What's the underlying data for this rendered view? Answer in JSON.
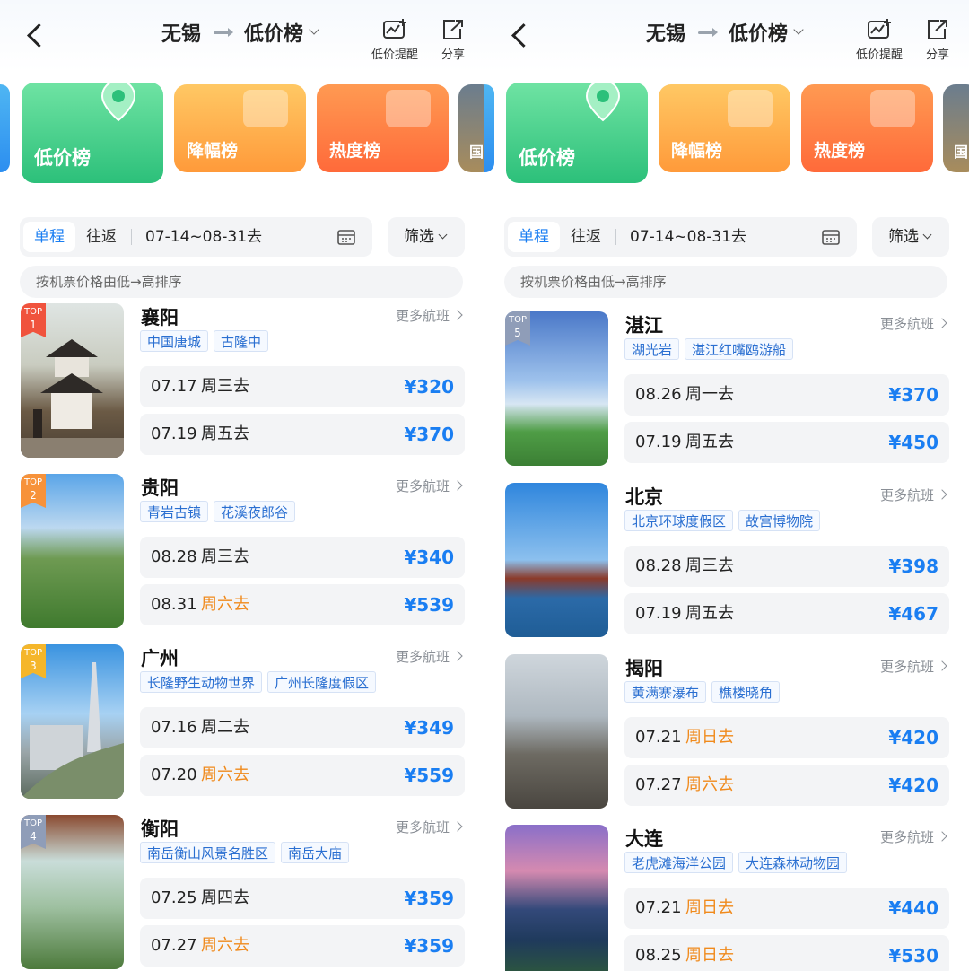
{
  "panels": [
    {
      "header": {
        "from": "无锡",
        "board": "低价榜",
        "remind_label": "低价提醒",
        "share_label": "分享"
      },
      "categories": [
        {
          "label": "低价榜"
        },
        {
          "label": "降幅榜"
        },
        {
          "label": "热度榜"
        },
        {
          "label": "国"
        }
      ],
      "filter": {
        "one_way": "单程",
        "round_trip": "往返",
        "date_range": "07-14~08-31去",
        "screen": "筛选"
      },
      "sort_text": "按机票价格由低→高排序",
      "more_label": "更多航班",
      "rows": [
        {
          "rank_top": "TOP",
          "rank": "1",
          "city": "襄阳",
          "tags": [
            "中国唐城",
            "古隆中"
          ],
          "fares": [
            {
              "date": "07.17",
              "weekday": "周三去",
              "price": "¥320",
              "weekend": false
            },
            {
              "date": "07.19",
              "weekday": "周五去",
              "price": "¥370",
              "weekend": false
            }
          ]
        },
        {
          "rank_top": "TOP",
          "rank": "2",
          "city": "贵阳",
          "tags": [
            "青岩古镇",
            "花溪夜郎谷"
          ],
          "fares": [
            {
              "date": "08.28",
              "weekday": "周三去",
              "price": "¥340",
              "weekend": false
            },
            {
              "date": "08.31",
              "weekday": "周六去",
              "price": "¥539",
              "weekend": true
            }
          ]
        },
        {
          "rank_top": "TOP",
          "rank": "3",
          "city": "广州",
          "tags": [
            "长隆野生动物世界",
            "广州长隆度假区"
          ],
          "fares": [
            {
              "date": "07.16",
              "weekday": "周二去",
              "price": "¥349",
              "weekend": false
            },
            {
              "date": "07.20",
              "weekday": "周六去",
              "price": "¥559",
              "weekend": true
            }
          ]
        },
        {
          "rank_top": "TOP",
          "rank": "4",
          "city": "衡阳",
          "tags": [
            "南岳衡山风景名胜区",
            "南岳大庙"
          ],
          "fares": [
            {
              "date": "07.25",
              "weekday": "周四去",
              "price": "¥359",
              "weekend": false
            },
            {
              "date": "07.27",
              "weekday": "周六去",
              "price": "¥359",
              "weekend": true
            }
          ]
        }
      ]
    },
    {
      "header": {
        "from": "无锡",
        "board": "低价榜",
        "remind_label": "低价提醒",
        "share_label": "分享"
      },
      "categories": [
        {
          "label": "低价榜"
        },
        {
          "label": "降幅榜"
        },
        {
          "label": "热度榜"
        },
        {
          "label": "国"
        }
      ],
      "filter": {
        "one_way": "单程",
        "round_trip": "往返",
        "date_range": "07-14~08-31去",
        "screen": "筛选"
      },
      "sort_text": "按机票价格由低→高排序",
      "more_label": "更多航班",
      "rows": [
        {
          "rank_top": "TOP",
          "rank": "5",
          "city": "湛江",
          "tags": [
            "湖光岩",
            "湛江红嘴鸥游船"
          ],
          "fares": [
            {
              "date": "08.26",
              "weekday": "周一去",
              "price": "¥370",
              "weekend": false
            },
            {
              "date": "07.19",
              "weekday": "周五去",
              "price": "¥450",
              "weekend": false
            }
          ]
        },
        {
          "rank_top": "",
          "rank": "",
          "city": "北京",
          "tags": [
            "北京环球度假区",
            "故宫博物院"
          ],
          "fares": [
            {
              "date": "08.28",
              "weekday": "周三去",
              "price": "¥398",
              "weekend": false
            },
            {
              "date": "07.19",
              "weekday": "周五去",
              "price": "¥467",
              "weekend": false
            }
          ]
        },
        {
          "rank_top": "",
          "rank": "",
          "city": "揭阳",
          "tags": [
            "黄满寨瀑布",
            "樵楼晓角"
          ],
          "fares": [
            {
              "date": "07.21",
              "weekday": "周日去",
              "price": "¥420",
              "weekend": true
            },
            {
              "date": "07.27",
              "weekday": "周六去",
              "price": "¥420",
              "weekend": true
            }
          ]
        },
        {
          "rank_top": "",
          "rank": "",
          "city": "大连",
          "tags": [
            "老虎滩海洋公园",
            "大连森林动物园"
          ],
          "fares": [
            {
              "date": "07.21",
              "weekday": "周日去",
              "price": "¥440",
              "weekend": true
            },
            {
              "date": "08.25",
              "weekday": "周日去",
              "price": "¥530",
              "weekend": true
            }
          ]
        }
      ]
    }
  ],
  "colors": {
    "accent": "#1a7ef2",
    "weekend": "#f08a1c",
    "low_card": "#2cc07a",
    "drop_card": "#ff9a3a",
    "hot_card": "#ff6a3a"
  }
}
